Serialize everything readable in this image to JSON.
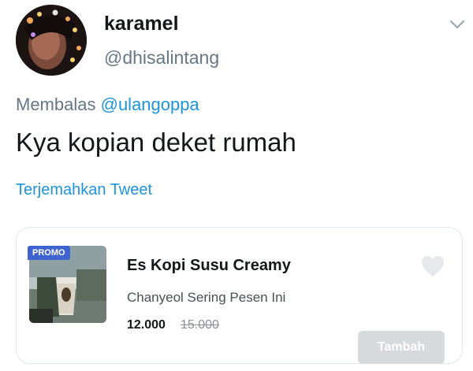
{
  "tweet": {
    "display_name": "karamel",
    "handle": "@dhisalintang",
    "reply_prefix": "Membalas",
    "reply_to": "@ulangoppa",
    "text": "Kya kopian deket rumah",
    "translate_label": "Terjemahkan Tweet"
  },
  "icons": {
    "menu": "chevron-down-icon",
    "favorite": "heart-icon"
  },
  "ad_card": {
    "badge": "PROMO",
    "title": "Es Kopi Susu Creamy",
    "subtitle": "Chanyeol Sering Pesen Ini",
    "price": "12.000",
    "original_price": "15.000",
    "button_label": "Tambah"
  },
  "colors": {
    "link": "#1b95e0",
    "secondary_text": "#657786",
    "promo_badge": "#3f63cf",
    "button_disabled": "#d7dadc"
  }
}
